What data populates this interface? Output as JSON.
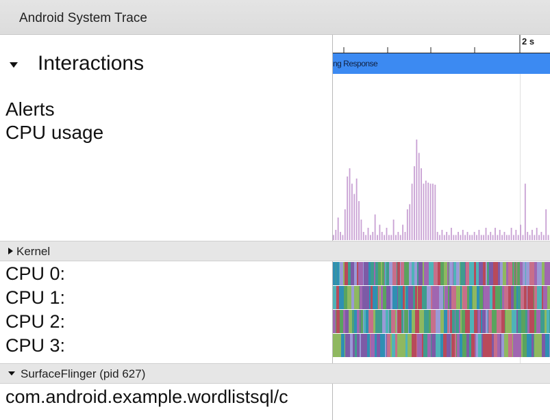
{
  "window": {
    "title": "Android System Trace"
  },
  "tracks": {
    "interactions": {
      "label": "Interactions",
      "expanded": true
    },
    "alerts": {
      "label": "Alerts"
    },
    "cpu_usage": {
      "label": "CPU usage"
    }
  },
  "kernel": {
    "label": "Kernel",
    "expanded": false,
    "cpus": [
      {
        "label": "CPU 0:"
      },
      {
        "label": "CPU 1:"
      },
      {
        "label": "CPU 2:"
      },
      {
        "label": "CPU 3:"
      }
    ]
  },
  "process": {
    "label": "SurfaceFlinger (pid 627)",
    "expanded": true,
    "thread": "com.android.example.wordlistsql/c"
  },
  "timeline": {
    "marker_label": "2 s",
    "interaction_label": "ng Response"
  },
  "colors": {
    "interaction_bar": "#3c8af2",
    "cpu_usage": "#c9a2d4",
    "slice_palette": [
      "#b84a5a",
      "#7d5aa6",
      "#3f9c8e",
      "#5aa35e",
      "#9a9ad6",
      "#2f8fb3",
      "#c76f8a",
      "#8fb860",
      "#4fb3b8",
      "#a066b0",
      "#e0e0e0"
    ]
  },
  "chart_data": {
    "type": "bar",
    "series": [
      {
        "values": [
          0.05,
          0.1,
          0.22,
          0.08,
          0.05,
          0.3,
          0.62,
          0.7,
          0.55,
          0.45,
          0.6,
          0.38,
          0.2,
          0.08,
          0.05,
          0.12,
          0.05,
          0.08,
          0.25,
          0.05,
          0.15,
          0.08,
          0.05,
          0.12,
          0.05,
          0.05,
          0.2,
          0.05,
          0.08,
          0.05,
          0.15,
          0.08,
          0.3,
          0.35,
          0.55,
          0.72,
          0.98,
          0.85,
          0.7,
          0.55,
          0.58,
          0.56,
          0.55,
          0.55,
          0.54,
          0.08,
          0.05,
          0.1,
          0.05,
          0.08,
          0.05,
          0.12,
          0.05,
          0.05,
          0.08,
          0.05,
          0.1,
          0.05,
          0.08,
          0.05,
          0.05,
          0.08,
          0.05,
          0.1,
          0.05,
          0.05,
          0.12,
          0.05,
          0.08,
          0.05,
          0.12,
          0.05,
          0.1,
          0.05,
          0.08,
          0.05,
          0.05,
          0.12,
          0.05,
          0.1,
          0.05,
          0.15,
          0.05,
          0.55,
          0.08,
          0.05,
          0.1,
          0.05,
          0.12,
          0.05,
          0.08,
          0.05,
          0.3,
          0.05
        ]
      }
    ]
  }
}
